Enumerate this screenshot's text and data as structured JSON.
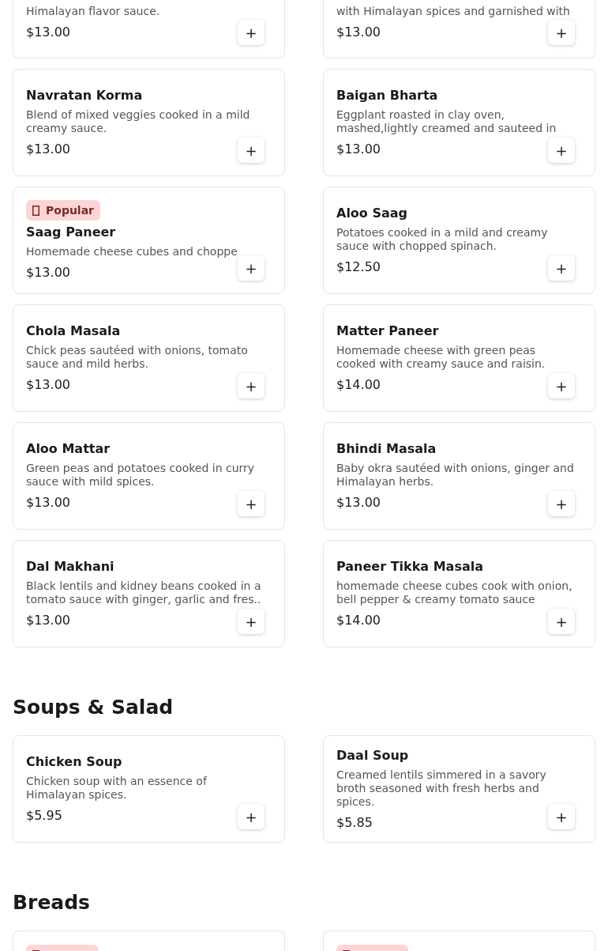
{
  "sections": [
    {
      "items": [
        {
          "description": "Himalayan flavor sauce.",
          "price": "$13.00",
          "add": "+"
        },
        {
          "description": "with Himalayan spices and garnished with",
          "price": "$13.00",
          "add": "+"
        },
        {
          "name": "Navratan Korma",
          "description": "Blend of mixed veggies cooked in a mild creamy sauce.",
          "price": "$13.00",
          "add": "+"
        },
        {
          "name": "Baigan Bharta",
          "description": "Eggplant roasted in clay oven, mashed,lightly creamed and sauteed in",
          "price": "$13.00",
          "add": "+"
        },
        {
          "badge": "Popular",
          "name": "Saag Paneer",
          "description": "Homemade cheese cubes and choppe",
          "price": "$13.00",
          "add": "+"
        },
        {
          "name": "Aloo Saag",
          "description": "Potatoes cooked in a mild and creamy sauce with chopped spinach.",
          "price": "$12.50",
          "add": "+"
        },
        {
          "name": "Chola Masala",
          "description": "Chick peas sautéed with onions, tomato sauce and mild herbs.",
          "price": "$13.00",
          "add": "+"
        },
        {
          "name": "Matter Paneer",
          "description": "Homemade cheese with green peas cooked with creamy sauce and raisin.",
          "price": "$14.00",
          "add": "+"
        },
        {
          "name": "Aloo Mattar",
          "description": "Green peas and potatoes cooked in curry sauce with mild spices.",
          "price": "$13.00",
          "add": "+"
        },
        {
          "name": "Bhindi Masala",
          "description": "Baby okra sautéed with onions, ginger and Himalayan herbs.",
          "price": "$13.00",
          "add": "+"
        },
        {
          "name": "Dal Makhani",
          "description": "Black lentils and kidney beans cooked in a tomato sauce with ginger, garlic and fres..",
          "price": "$13.00",
          "add": "+"
        },
        {
          "name": "Paneer Tikka Masala",
          "description": "homemade cheese cubes cook with onion, bell pepper & creamy tomato sauce",
          "price": "$14.00",
          "add": "+"
        }
      ]
    },
    {
      "title": "Soups & Salad",
      "items": [
        {
          "name": "Chicken Soup",
          "description": "Chicken soup with an essence of Himalayan spices.",
          "price": "$5.95",
          "add": "+"
        },
        {
          "name": "Daal Soup",
          "description": "Creamed lentils simmered in a savory broth seasoned with fresh herbs and spices.",
          "price": "$5.85",
          "add": "+"
        }
      ]
    },
    {
      "title": "Breads",
      "items": [
        {
          "popular": true
        },
        {
          "popular": true
        }
      ]
    }
  ]
}
